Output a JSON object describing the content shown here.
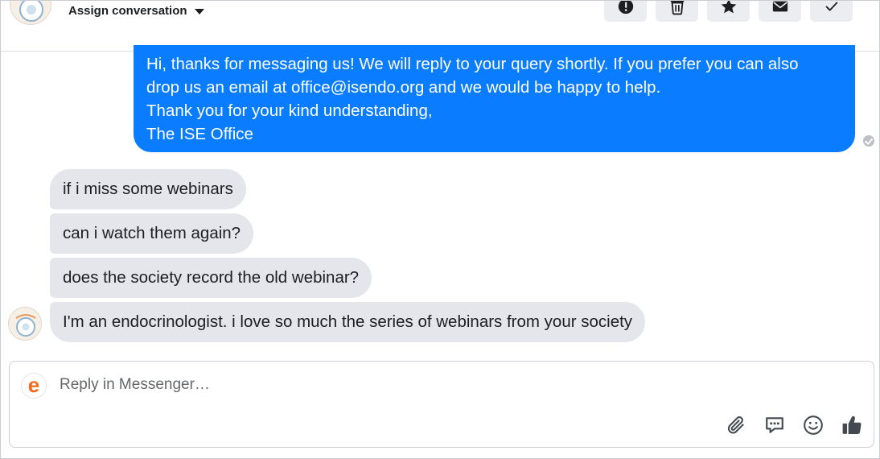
{
  "header": {
    "assign_label": "Assign conversation",
    "actions": [
      {
        "name": "report-spam-button",
        "icon": "alert-circle-icon"
      },
      {
        "name": "delete-button",
        "icon": "trash-icon"
      },
      {
        "name": "star-button",
        "icon": "star-icon"
      },
      {
        "name": "mark-unread-button",
        "icon": "envelope-icon"
      },
      {
        "name": "mark-done-button",
        "icon": "check-icon"
      }
    ]
  },
  "conversation": {
    "outgoing": {
      "lines": [
        "Hi, thanks for messaging us! We will reply to your query shortly. If you prefer you can also",
        "drop us an email at office@isendo.org and we would be happy to help.",
        "Thank you for your kind understanding,",
        "The ISE Office"
      ]
    },
    "incoming": [
      "if i miss some webinars",
      "can i watch them again?",
      "does the society record the old webinar?",
      "I'm an endocrinologist. i love so much the series of webinars  from your society"
    ]
  },
  "reply": {
    "placeholder": "Reply in Messenger…",
    "logo_letter": "e"
  },
  "colors": {
    "outgoing_bubble": "#0a7cff",
    "incoming_bubble": "#e4e6eb",
    "logo_orange": "#f26b1d"
  }
}
